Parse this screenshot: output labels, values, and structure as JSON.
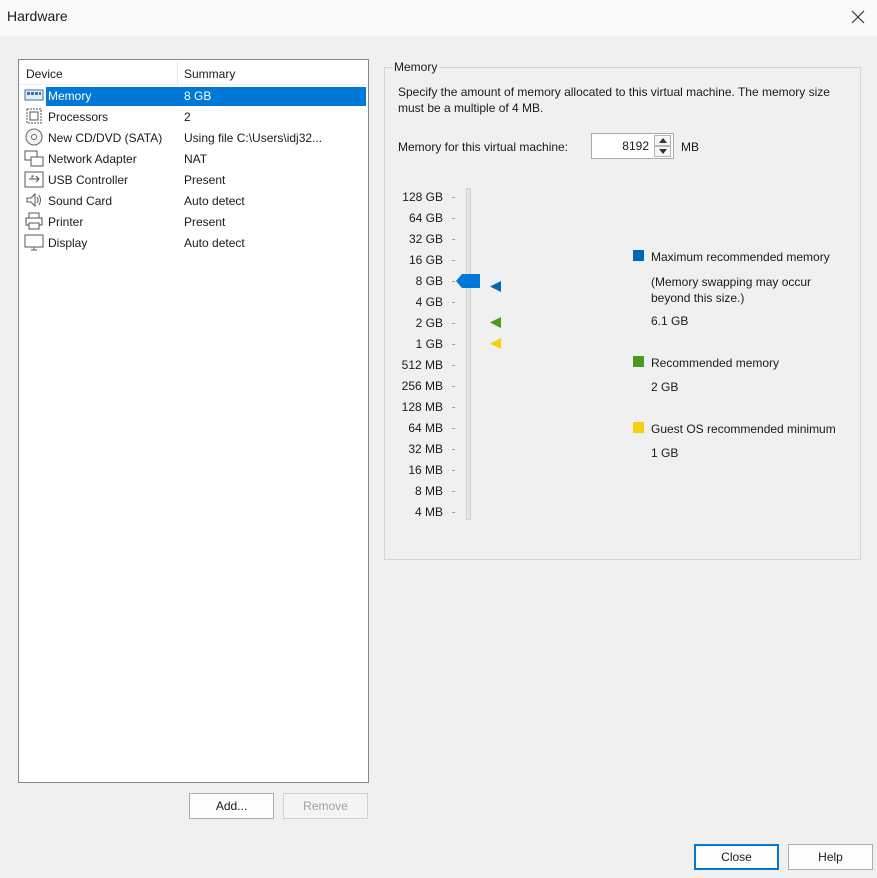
{
  "window": {
    "title": "Hardware"
  },
  "device_list": {
    "columns": {
      "device": "Device",
      "summary": "Summary"
    },
    "items": [
      {
        "name": "Memory",
        "summary": "8 GB",
        "icon": "memory-icon",
        "selected": true
      },
      {
        "name": "Processors",
        "summary": "2",
        "icon": "processor-icon"
      },
      {
        "name": "New CD/DVD (SATA)",
        "summary": "Using file C:\\Users\\idj32...",
        "icon": "cd-dvd-icon"
      },
      {
        "name": "Network Adapter",
        "summary": "NAT",
        "icon": "network-adapter-icon"
      },
      {
        "name": "USB Controller",
        "summary": "Present",
        "icon": "usb-icon"
      },
      {
        "name": "Sound Card",
        "summary": "Auto detect",
        "icon": "speaker-icon"
      },
      {
        "name": "Printer",
        "summary": "Present",
        "icon": "printer-icon"
      },
      {
        "name": "Display",
        "summary": "Auto detect",
        "icon": "monitor-icon"
      }
    ]
  },
  "buttons": {
    "add": "Add...",
    "remove": "Remove",
    "close": "Close",
    "help": "Help"
  },
  "memory": {
    "group_title": "Memory",
    "description": "Specify the amount of memory allocated to this virtual machine. The memory size must be a multiple of 4 MB.",
    "field_label": "Memory for this virtual machine:",
    "value": "8192",
    "unit": "MB",
    "scale_labels": [
      "128 GB",
      "64 GB",
      "32 GB",
      "16 GB",
      "8 GB",
      "4 GB",
      "2 GB",
      "1 GB",
      "512 MB",
      "256 MB",
      "128 MB",
      "64 MB",
      "32 MB",
      "16 MB",
      "8 MB",
      "4 MB"
    ],
    "current_level": "8 GB",
    "legend": {
      "max": {
        "title": "Maximum recommended memory",
        "note": "(Memory swapping may occur beyond this size.)",
        "value": "6.1 GB",
        "color": "#0067b8"
      },
      "recommended": {
        "title": "Recommended memory",
        "value": "2 GB",
        "color": "#4a9a1e"
      },
      "guest_min": {
        "title": "Guest OS recommended minimum",
        "value": "1 GB",
        "color": "#f4d10a"
      }
    },
    "markers": {
      "max_level": "4 GB..8 GB",
      "recommended_level": "2 GB",
      "guest_min_level": "1 GB"
    }
  },
  "colors": {
    "selection": "#0078d7",
    "accent": "#0078d7"
  }
}
